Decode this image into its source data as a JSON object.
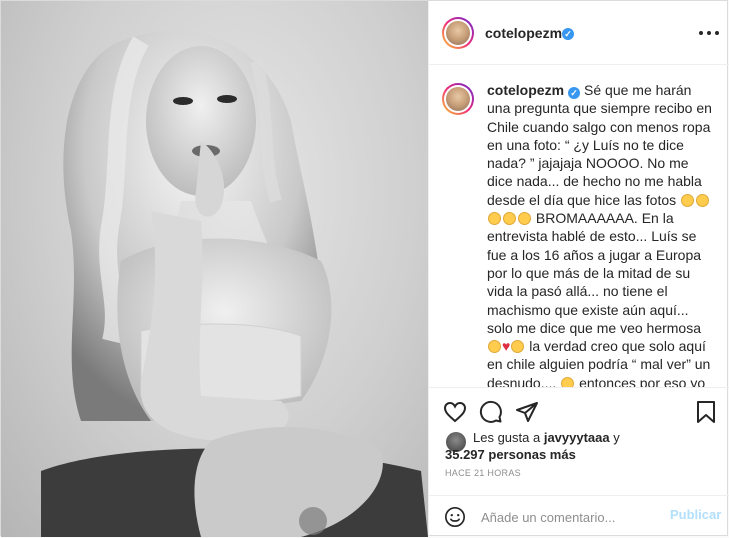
{
  "post": {
    "username": "cotelopezm",
    "caption_parts": {
      "p1": "Sé que me harán una pregunta que siempre recibo en Chile cuando salgo con menos ropa en una foto: “ ¿y Luís no te dice nada? ” jajajaja NOOOO. No me dice nada... de hecho no me habla desde el día que hice las fotos",
      "p2": "BROMAAAAAA. En la entrevista hablé de esto... Luís se fue a los 16 años a jugar a Europa por lo que más de la mitad de su vida la pasó allá... no tiene el machismo que existe aún aquí... solo me dice que me veo hermosa",
      "p3": "la verdad creo que solo aquí en chile alguien podría “ mal ver” un desnudo....",
      "p4": "entonces por eso yo me negué rotundamente inmediatamente a hacerlo!!!! Jajajajjaa"
    },
    "likes": {
      "prefix": "Les gusta a",
      "user": "javyyytaaa",
      "conjunction": "y",
      "count_text": "35.297 personas más"
    },
    "timestamp": "HACE 21 HORAS",
    "comment": {
      "placeholder": "Añade un comentario...",
      "publish_label": "Publicar"
    }
  },
  "icons": {
    "verified": "verified-badge-icon",
    "more": "more-options-icon",
    "like": "heart-icon",
    "comment": "comment-icon",
    "share": "share-icon",
    "save": "bookmark-icon",
    "emoji": "smiley-icon"
  },
  "colors": {
    "verified_blue": "#3897f0",
    "publish_disabled": "#b2dffc",
    "secondary_text": "#8e8e8e"
  }
}
